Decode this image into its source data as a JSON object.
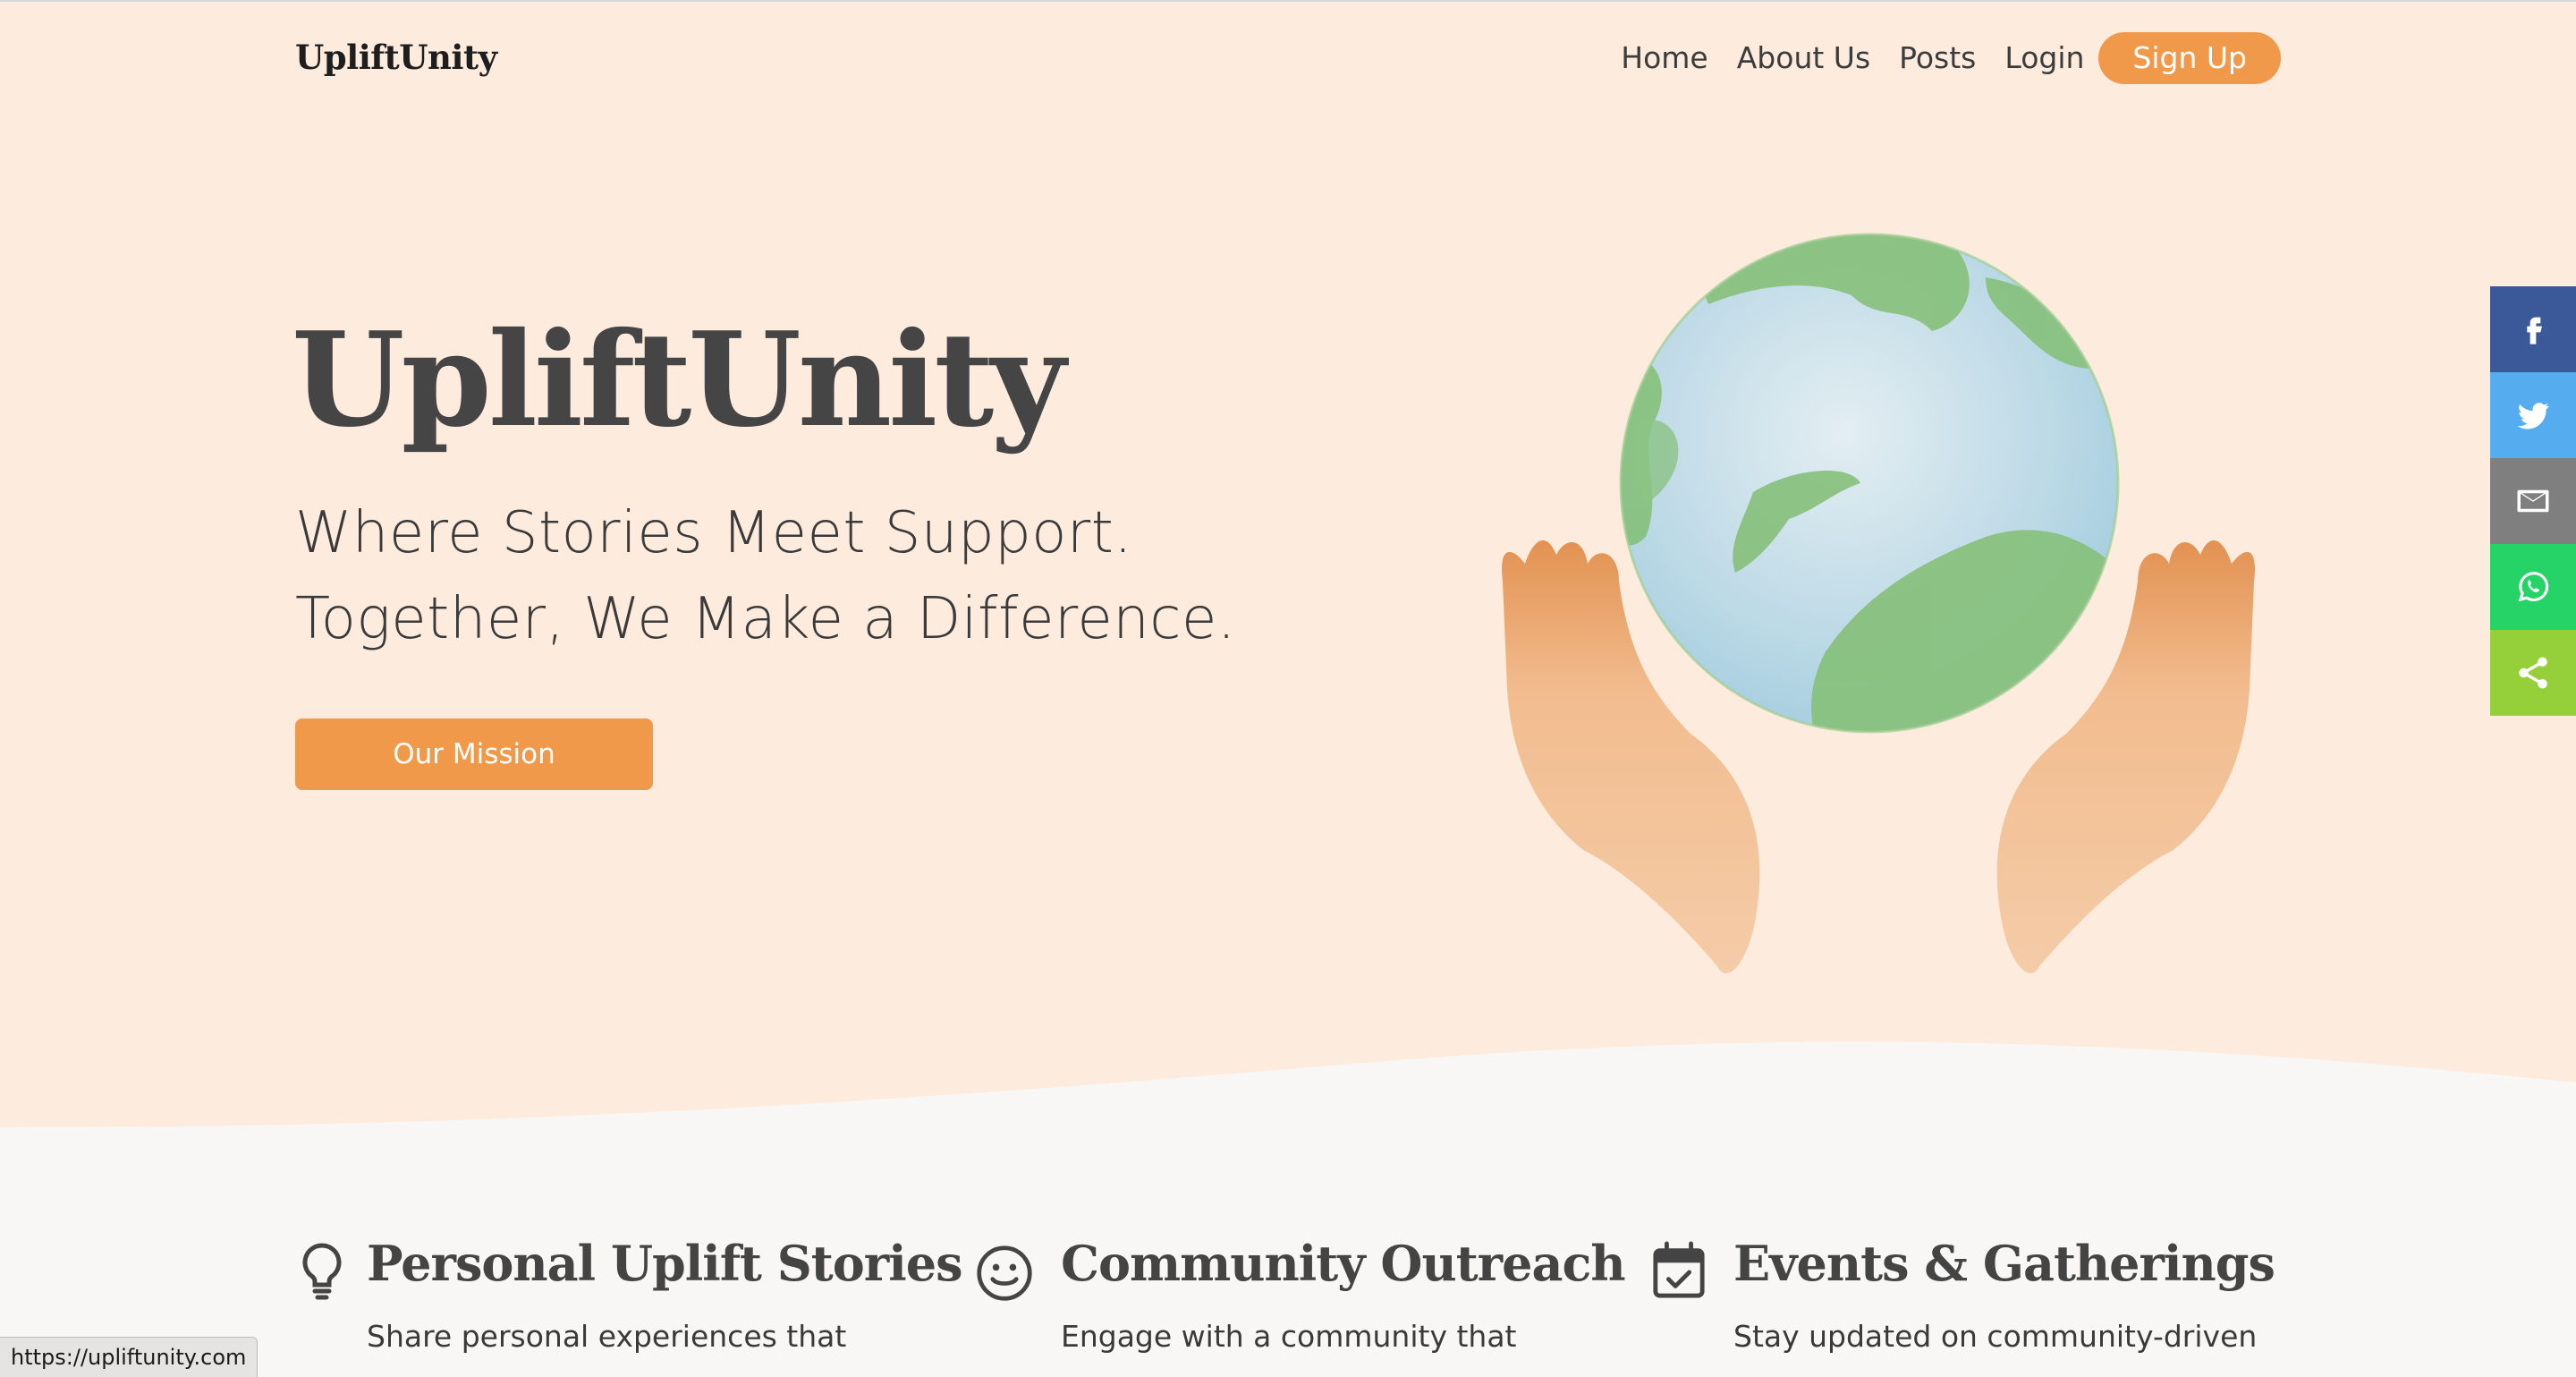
{
  "brand": {
    "logo_text": "UpliftUnity"
  },
  "nav": {
    "items": [
      {
        "label": "Home"
      },
      {
        "label": "About Us"
      },
      {
        "label": "Posts"
      },
      {
        "label": "Login"
      }
    ],
    "signup_label": "Sign Up"
  },
  "hero": {
    "title": "UpliftUnity",
    "tagline_line1": "Where Stories Meet Support.",
    "tagline_line2": "Together, We Make a Difference.",
    "cta_label": "Our Mission"
  },
  "share_bar": [
    {
      "icon": "facebook-icon",
      "color": "#3b5998"
    },
    {
      "icon": "twitter-icon",
      "color": "#55acee"
    },
    {
      "icon": "email-icon",
      "color": "#7f7f7f"
    },
    {
      "icon": "whatsapp-icon",
      "color": "#25d366"
    },
    {
      "icon": "share-icon",
      "color": "#95d03a"
    }
  ],
  "features": [
    {
      "icon": "lightbulb-icon",
      "title": "Personal Uplift Stories",
      "description": "Share personal experiences that"
    },
    {
      "icon": "smiley-icon",
      "title": "Community Outreach",
      "description": "Engage with a community that"
    },
    {
      "icon": "calendar-check-icon",
      "title": "Events & Gatherings",
      "description": "Stay updated on community-driven"
    }
  ],
  "status_bar": {
    "url": "https://upliftunity.com"
  },
  "colors": {
    "accent": "#f0994a",
    "hero_bg": "#fdecdd",
    "page_bg": "#f9f7f5",
    "heading": "#454545"
  }
}
